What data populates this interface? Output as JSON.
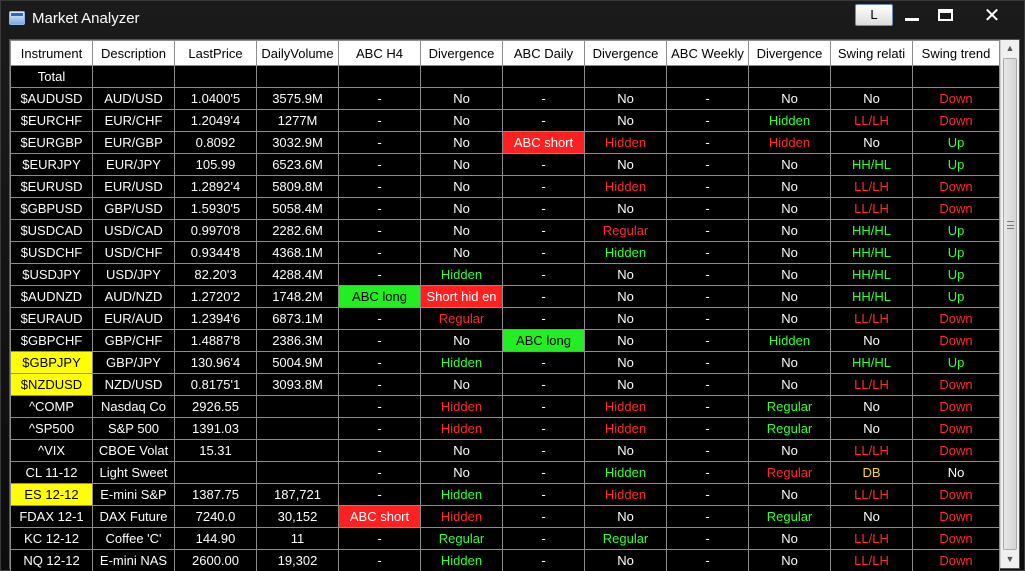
{
  "window": {
    "title": "Market Analyzer",
    "layout_button": "L",
    "close_glyph": "✕"
  },
  "colors": {
    "white": "#ffffff",
    "red": "#ff2a2a",
    "green": "#33ff33",
    "yellow": "#ffd800",
    "cell_red_bg": "#ff2020",
    "cell_green_bg": "#22ee22",
    "cell_yellow_bg": "#ffff00",
    "black": "#000000"
  },
  "columns": [
    "Instrument",
    "Description",
    "LastPrice",
    "DailyVolume",
    "ABC H4",
    "Divergence",
    "ABC Daily",
    "Divergence",
    "ABC Weekly",
    "Divergence",
    "Swing relati",
    "Swing trend"
  ],
  "rows": [
    {
      "cells": [
        {
          "t": "Total"
        },
        {
          "t": ""
        },
        {
          "t": ""
        },
        {
          "t": ""
        },
        {
          "t": ""
        },
        {
          "t": ""
        },
        {
          "t": ""
        },
        {
          "t": ""
        },
        {
          "t": ""
        },
        {
          "t": ""
        },
        {
          "t": ""
        },
        {
          "t": ""
        }
      ]
    },
    {
      "cells": [
        {
          "t": "$AUDUSD"
        },
        {
          "t": "AUD/USD"
        },
        {
          "t": "1.0400'5"
        },
        {
          "t": "3575.9M"
        },
        {
          "t": "-"
        },
        {
          "t": "No"
        },
        {
          "t": "-"
        },
        {
          "t": "No"
        },
        {
          "t": "-"
        },
        {
          "t": "No"
        },
        {
          "t": "No"
        },
        {
          "t": "Down",
          "c": "red"
        }
      ]
    },
    {
      "cells": [
        {
          "t": "$EURCHF"
        },
        {
          "t": "EUR/CHF"
        },
        {
          "t": "1.2049'4"
        },
        {
          "t": "1277M"
        },
        {
          "t": "-"
        },
        {
          "t": "No"
        },
        {
          "t": "-"
        },
        {
          "t": "No"
        },
        {
          "t": "-"
        },
        {
          "t": "Hidden",
          "c": "green"
        },
        {
          "t": "LL/LH",
          "c": "red"
        },
        {
          "t": "Down",
          "c": "red"
        }
      ]
    },
    {
      "cells": [
        {
          "t": "$EURGBP"
        },
        {
          "t": "EUR/GBP"
        },
        {
          "t": "0.8092"
        },
        {
          "t": "3032.9M"
        },
        {
          "t": "-"
        },
        {
          "t": "No"
        },
        {
          "t": "ABC short",
          "bg": "cell_red_bg"
        },
        {
          "t": "Hidden",
          "c": "red"
        },
        {
          "t": "-"
        },
        {
          "t": "Hidden",
          "c": "red"
        },
        {
          "t": "No"
        },
        {
          "t": "Up",
          "c": "green"
        }
      ]
    },
    {
      "cells": [
        {
          "t": "$EURJPY"
        },
        {
          "t": "EUR/JPY"
        },
        {
          "t": "105.99"
        },
        {
          "t": "6523.6M"
        },
        {
          "t": "-"
        },
        {
          "t": "No"
        },
        {
          "t": "-"
        },
        {
          "t": "No"
        },
        {
          "t": "-"
        },
        {
          "t": "No"
        },
        {
          "t": "HH/HL",
          "c": "green"
        },
        {
          "t": "Up",
          "c": "green"
        }
      ]
    },
    {
      "cells": [
        {
          "t": "$EURUSD"
        },
        {
          "t": "EUR/USD"
        },
        {
          "t": "1.2892'4"
        },
        {
          "t": "5809.8M"
        },
        {
          "t": "-"
        },
        {
          "t": "No"
        },
        {
          "t": "-"
        },
        {
          "t": "Hidden",
          "c": "red"
        },
        {
          "t": "-"
        },
        {
          "t": "No"
        },
        {
          "t": "LL/LH",
          "c": "red"
        },
        {
          "t": "Down",
          "c": "red"
        }
      ]
    },
    {
      "cells": [
        {
          "t": "$GBPUSD"
        },
        {
          "t": "GBP/USD"
        },
        {
          "t": "1.5930'5"
        },
        {
          "t": "5058.4M"
        },
        {
          "t": "-"
        },
        {
          "t": "No"
        },
        {
          "t": "-"
        },
        {
          "t": "No"
        },
        {
          "t": "-"
        },
        {
          "t": "No"
        },
        {
          "t": "LL/LH",
          "c": "red"
        },
        {
          "t": "Down",
          "c": "red"
        }
      ]
    },
    {
      "cells": [
        {
          "t": "$USDCAD"
        },
        {
          "t": "USD/CAD"
        },
        {
          "t": "0.9970'8"
        },
        {
          "t": "2282.6M"
        },
        {
          "t": "-"
        },
        {
          "t": "No"
        },
        {
          "t": "-"
        },
        {
          "t": "Regular",
          "c": "red"
        },
        {
          "t": "-"
        },
        {
          "t": "No"
        },
        {
          "t": "HH/HL",
          "c": "green"
        },
        {
          "t": "Up",
          "c": "green"
        }
      ]
    },
    {
      "cells": [
        {
          "t": "$USDCHF"
        },
        {
          "t": "USD/CHF"
        },
        {
          "t": "0.9344'8"
        },
        {
          "t": "4368.1M"
        },
        {
          "t": "-"
        },
        {
          "t": "No"
        },
        {
          "t": "-"
        },
        {
          "t": "Hidden",
          "c": "green"
        },
        {
          "t": "-"
        },
        {
          "t": "No"
        },
        {
          "t": "HH/HL",
          "c": "green"
        },
        {
          "t": "Up",
          "c": "green"
        }
      ]
    },
    {
      "cells": [
        {
          "t": "$USDJPY"
        },
        {
          "t": "USD/JPY"
        },
        {
          "t": "82.20'3"
        },
        {
          "t": "4288.4M"
        },
        {
          "t": "-"
        },
        {
          "t": "Hidden",
          "c": "green"
        },
        {
          "t": "-"
        },
        {
          "t": "No"
        },
        {
          "t": "-"
        },
        {
          "t": "No"
        },
        {
          "t": "HH/HL",
          "c": "green"
        },
        {
          "t": "Up",
          "c": "green"
        }
      ]
    },
    {
      "cells": [
        {
          "t": "$AUDNZD"
        },
        {
          "t": "AUD/NZD"
        },
        {
          "t": "1.2720'2"
        },
        {
          "t": "1748.2M"
        },
        {
          "t": "ABC long",
          "bg": "cell_green_bg",
          "c": "black"
        },
        {
          "t": "Short hid en",
          "bg": "cell_red_bg"
        },
        {
          "t": "-"
        },
        {
          "t": "No"
        },
        {
          "t": "-"
        },
        {
          "t": "No"
        },
        {
          "t": "HH/HL",
          "c": "green"
        },
        {
          "t": "Up",
          "c": "green"
        }
      ]
    },
    {
      "cells": [
        {
          "t": "$EURAUD"
        },
        {
          "t": "EUR/AUD"
        },
        {
          "t": "1.2394'6"
        },
        {
          "t": "6873.1M"
        },
        {
          "t": "-"
        },
        {
          "t": "Regular",
          "c": "red"
        },
        {
          "t": "-"
        },
        {
          "t": "No"
        },
        {
          "t": "-"
        },
        {
          "t": "No"
        },
        {
          "t": "LL/LH",
          "c": "red"
        },
        {
          "t": "Down",
          "c": "red"
        }
      ]
    },
    {
      "cells": [
        {
          "t": "$GBPCHF"
        },
        {
          "t": "GBP/CHF"
        },
        {
          "t": "1.4887'8"
        },
        {
          "t": "2386.3M"
        },
        {
          "t": "-"
        },
        {
          "t": "No"
        },
        {
          "t": "ABC long",
          "bg": "cell_green_bg",
          "c": "black"
        },
        {
          "t": "No"
        },
        {
          "t": "-"
        },
        {
          "t": "Hidden",
          "c": "green"
        },
        {
          "t": "No"
        },
        {
          "t": "Down",
          "c": "red"
        }
      ]
    },
    {
      "cells": [
        {
          "t": "$GBPJPY",
          "bg": "cell_yellow_bg",
          "c": "black"
        },
        {
          "t": "GBP/JPY"
        },
        {
          "t": "130.96'4"
        },
        {
          "t": "5004.9M"
        },
        {
          "t": "-"
        },
        {
          "t": "Hidden",
          "c": "green"
        },
        {
          "t": "-"
        },
        {
          "t": "No"
        },
        {
          "t": "-"
        },
        {
          "t": "No"
        },
        {
          "t": "HH/HL",
          "c": "green"
        },
        {
          "t": "Up",
          "c": "green"
        }
      ]
    },
    {
      "cells": [
        {
          "t": "$NZDUSD",
          "bg": "cell_yellow_bg",
          "c": "black"
        },
        {
          "t": "NZD/USD"
        },
        {
          "t": "0.8175'1"
        },
        {
          "t": "3093.8M"
        },
        {
          "t": "-"
        },
        {
          "t": "No"
        },
        {
          "t": "-"
        },
        {
          "t": "No"
        },
        {
          "t": "-"
        },
        {
          "t": "No"
        },
        {
          "t": "LL/LH",
          "c": "red"
        },
        {
          "t": "Down",
          "c": "red"
        }
      ]
    },
    {
      "cells": [
        {
          "t": "^COMP"
        },
        {
          "t": "Nasdaq Co"
        },
        {
          "t": "2926.55"
        },
        {
          "t": ""
        },
        {
          "t": "-"
        },
        {
          "t": "Hidden",
          "c": "red"
        },
        {
          "t": "-"
        },
        {
          "t": "Hidden",
          "c": "red"
        },
        {
          "t": "-"
        },
        {
          "t": "Regular",
          "c": "green"
        },
        {
          "t": "No"
        },
        {
          "t": "Down",
          "c": "red"
        }
      ]
    },
    {
      "cells": [
        {
          "t": "^SP500"
        },
        {
          "t": "S&P 500"
        },
        {
          "t": "1391.03"
        },
        {
          "t": ""
        },
        {
          "t": "-"
        },
        {
          "t": "Hidden",
          "c": "red"
        },
        {
          "t": "-"
        },
        {
          "t": "Hidden",
          "c": "red"
        },
        {
          "t": "-"
        },
        {
          "t": "Regular",
          "c": "green"
        },
        {
          "t": "No"
        },
        {
          "t": "Down",
          "c": "red"
        }
      ]
    },
    {
      "cells": [
        {
          "t": "^VIX"
        },
        {
          "t": "CBOE Volat"
        },
        {
          "t": "15.31"
        },
        {
          "t": ""
        },
        {
          "t": "-"
        },
        {
          "t": "No"
        },
        {
          "t": "-"
        },
        {
          "t": "No"
        },
        {
          "t": "-"
        },
        {
          "t": "No"
        },
        {
          "t": "LL/LH",
          "c": "red"
        },
        {
          "t": "Down",
          "c": "red"
        }
      ]
    },
    {
      "cells": [
        {
          "t": "CL 11-12"
        },
        {
          "t": "Light Sweet"
        },
        {
          "t": ""
        },
        {
          "t": ""
        },
        {
          "t": "-"
        },
        {
          "t": "No"
        },
        {
          "t": "-"
        },
        {
          "t": "Hidden",
          "c": "green"
        },
        {
          "t": "-"
        },
        {
          "t": "Regular",
          "c": "red"
        },
        {
          "t": "DB",
          "c": "yellow"
        },
        {
          "t": "No"
        }
      ]
    },
    {
      "cells": [
        {
          "t": "ES 12-12",
          "bg": "cell_yellow_bg",
          "c": "black"
        },
        {
          "t": "E-mini S&P"
        },
        {
          "t": "1387.75"
        },
        {
          "t": "187,721"
        },
        {
          "t": "-"
        },
        {
          "t": "Hidden",
          "c": "green"
        },
        {
          "t": "-"
        },
        {
          "t": "Hidden",
          "c": "red"
        },
        {
          "t": "-"
        },
        {
          "t": "No"
        },
        {
          "t": "LL/LH",
          "c": "red"
        },
        {
          "t": "Down",
          "c": "red"
        }
      ]
    },
    {
      "cells": [
        {
          "t": "FDAX 12-1"
        },
        {
          "t": "DAX Future"
        },
        {
          "t": "7240.0"
        },
        {
          "t": "30,152"
        },
        {
          "t": "ABC short",
          "bg": "cell_red_bg"
        },
        {
          "t": "Hidden",
          "c": "red"
        },
        {
          "t": "-"
        },
        {
          "t": "No"
        },
        {
          "t": "-"
        },
        {
          "t": "Regular",
          "c": "green"
        },
        {
          "t": "No"
        },
        {
          "t": "Down",
          "c": "red"
        }
      ]
    },
    {
      "cells": [
        {
          "t": "KC 12-12"
        },
        {
          "t": "Coffee 'C'"
        },
        {
          "t": "144.90"
        },
        {
          "t": "11"
        },
        {
          "t": "-"
        },
        {
          "t": "Regular",
          "c": "green"
        },
        {
          "t": "-"
        },
        {
          "t": "Regular",
          "c": "green"
        },
        {
          "t": "-"
        },
        {
          "t": "No"
        },
        {
          "t": "LL/LH",
          "c": "red"
        },
        {
          "t": "Down",
          "c": "red"
        }
      ]
    },
    {
      "cells": [
        {
          "t": "NQ 12-12"
        },
        {
          "t": "E-mini NAS"
        },
        {
          "t": "2600.00"
        },
        {
          "t": "19,302"
        },
        {
          "t": "-"
        },
        {
          "t": "Hidden",
          "c": "green"
        },
        {
          "t": "-"
        },
        {
          "t": "No"
        },
        {
          "t": "-"
        },
        {
          "t": "No"
        },
        {
          "t": "LL/LH",
          "c": "red"
        },
        {
          "t": "Down",
          "c": "red"
        }
      ]
    }
  ],
  "scrollbar": {
    "up_glyph": "▲",
    "down_glyph": "▼"
  }
}
